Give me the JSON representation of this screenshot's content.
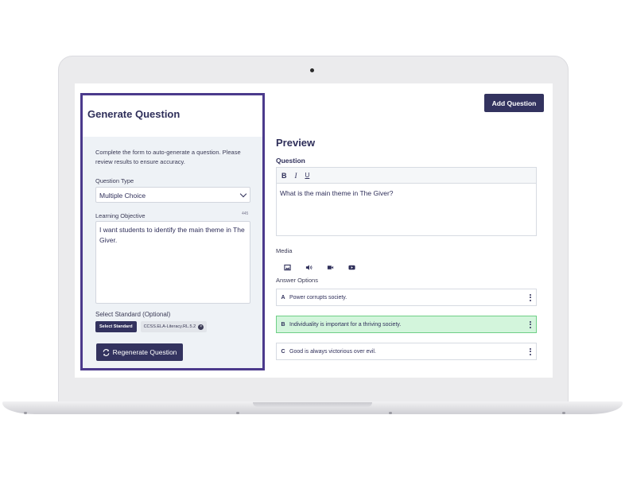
{
  "generate_panel": {
    "title": "Generate Question",
    "description": "Complete the form to auto-generate a question. Please review results to ensure accuracy.",
    "question_type_label": "Question Type",
    "question_type_value": "Multiple Choice",
    "learning_objective_label": "Learning Objective",
    "learning_objective_counter": "445",
    "learning_objective_value": "I want students to identify the main theme in The Giver.",
    "standard_label": "Select Standard (Optional)",
    "select_standard_button": "Select Standard",
    "standard_chip": "CCSS.ELA-Literacy.RL.5.2",
    "regenerate_button": "Regenerate Question"
  },
  "header": {
    "add_question_button": "Add Question"
  },
  "preview": {
    "title": "Preview",
    "question_label": "Question",
    "toolbar": {
      "bold": "B",
      "italic": "I",
      "underline": "U"
    },
    "question_text": "What is the main theme in The Giver?",
    "media_label": "Media",
    "media_icons": [
      "image-icon",
      "audio-icon",
      "video-icon",
      "youtube-icon"
    ],
    "answer_options_label": "Answer Options",
    "answers": [
      {
        "letter": "A",
        "text": "Power corrupts society.",
        "correct": false
      },
      {
        "letter": "B",
        "text": "Individuality is important for a thriving society.",
        "correct": true
      },
      {
        "letter": "C",
        "text": "Good is always victorious over evil.",
        "correct": false
      }
    ]
  },
  "colors": {
    "accent": "#33335f",
    "panel_border": "#4b3a8c",
    "correct_bg": "#d3f5dc",
    "correct_border": "#6fcf87"
  }
}
